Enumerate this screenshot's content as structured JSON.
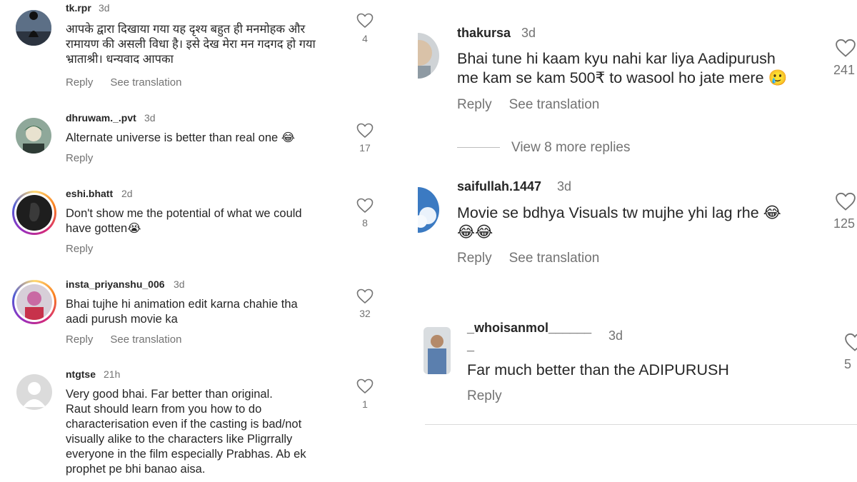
{
  "left": {
    "comments": [
      {
        "username": "tk.rpr",
        "time": "3d",
        "lines": [
          "आपके द्वारा दिखाया गया यह दृश्य बहुत ही मनमोहक और",
          "रामायण की असली विधा है। इसे देख मेरा मन गदगद हो गया",
          "भ्राताश्री। धन्यवाद आपका"
        ],
        "reply": "Reply",
        "see_translation": "See translation",
        "likes": "4"
      },
      {
        "username": "dhruwam._.pvt",
        "time": "3d",
        "lines": [
          "Alternate universe is better than real one 😂"
        ],
        "reply": "Reply",
        "likes": "17"
      },
      {
        "username": "eshi.bhatt",
        "time": "2d",
        "lines": [
          "Don't show me the potential of what we could",
          "have gotten😭"
        ],
        "reply": "Reply",
        "likes": "8"
      },
      {
        "username": "insta_priyanshu_006",
        "time": "3d",
        "lines": [
          "Bhai tujhe hi animation edit karna chahie tha",
          "aadi purush movie ka"
        ],
        "reply": "Reply",
        "see_translation": "See translation",
        "likes": "32"
      },
      {
        "username": "ntgtse",
        "time": "21h",
        "lines": [
          "Very good bhai. Far better than original.",
          "Raut should learn from you  how to do",
          "characterisation even if the casting is bad/not",
          "visually alike to the characters like Pligrrally",
          "everyone in the film especially Prabhas. Ab ek",
          "prophet pe bhi banao aisa."
        ],
        "likes": "1"
      }
    ]
  },
  "right": {
    "comments": [
      {
        "username": "thakursa",
        "time": "3d",
        "lines": [
          "Bhai tune hi kaam kyu nahi kar liya Aadipurush",
          "me kam se kam 500₹ to wasool ho jate mere 🥲"
        ],
        "reply": "Reply",
        "see_translation": "See translation",
        "likes": "241"
      },
      {
        "username": "saifullah.1447",
        "time": "3d",
        "lines": [
          "Movie se bdhya Visuals tw mujhe yhi lag rhe 😂",
          "😂😂"
        ],
        "reply": "Reply",
        "see_translation": "See translation",
        "likes": "125"
      },
      {
        "username": "_whoisanmol______",
        "username_line2": "_",
        "time": "3d",
        "lines": [
          "Far much better than the ADIPURUSH"
        ],
        "reply": "Reply",
        "likes": "5"
      }
    ],
    "view_more": "View 8 more replies"
  },
  "icons": {
    "like": "heart-outline-icon"
  },
  "colors": {
    "text": "#262626",
    "muted": "#737373",
    "divider": "#dbdbdb"
  }
}
